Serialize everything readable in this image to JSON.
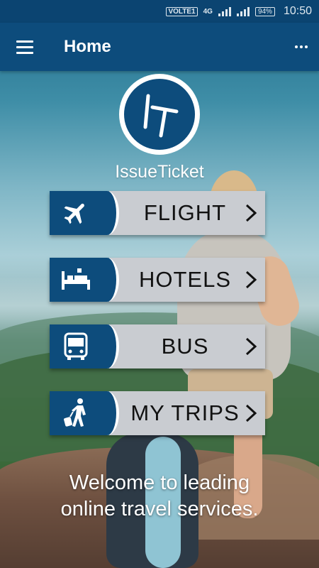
{
  "status_bar": {
    "network_label": "VOLTE1",
    "signal_label": "4G",
    "battery": "94%",
    "time": "10:50"
  },
  "app_bar": {
    "title": "Home",
    "menu_icon": "hamburger-menu-icon",
    "overflow_icon": "more-vert-icon"
  },
  "brand": {
    "logo_text": "IT",
    "name": "IssueTicket"
  },
  "menu": [
    {
      "label": "FLIGHT",
      "icon": "airplane-icon"
    },
    {
      "label": "HOTELS",
      "icon": "hotel-bed-icon"
    },
    {
      "label": "BUS",
      "icon": "bus-icon"
    },
    {
      "label": "MY TRIPS",
      "icon": "traveler-luggage-icon"
    }
  ],
  "welcome": {
    "line1": "Welcome to leading",
    "line2": "online travel services."
  },
  "colors": {
    "primary": "#0d4c7c",
    "button_bg": "#c9ccd1"
  }
}
